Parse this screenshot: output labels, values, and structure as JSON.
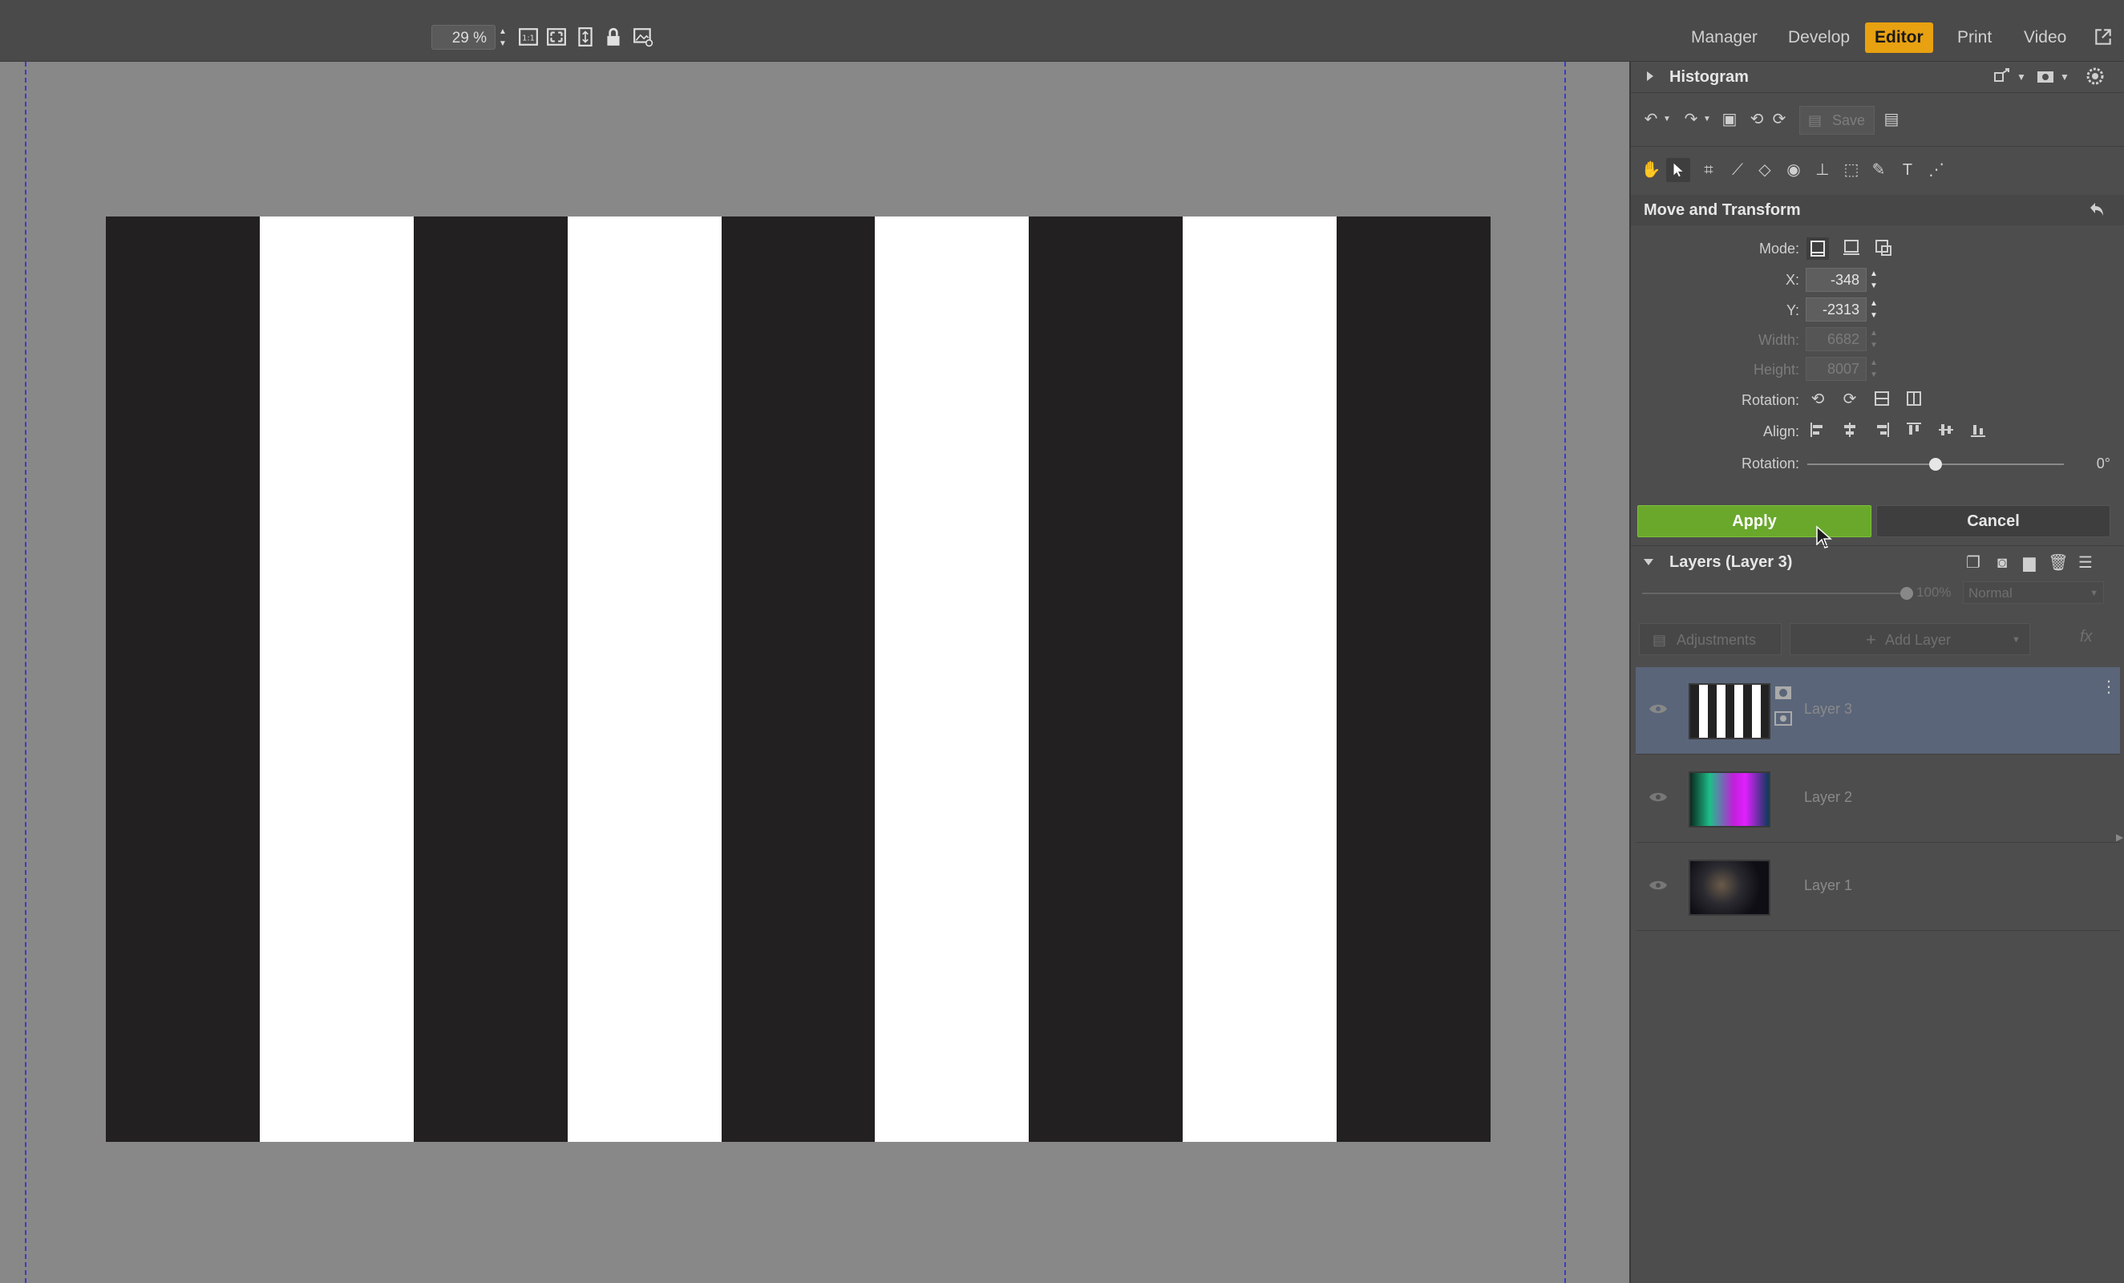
{
  "toolbar": {
    "zoom_value": "29 %",
    "icons": [
      "fit-1to1-icon",
      "fit-screen-icon",
      "fit-width-icon",
      "lock-icon",
      "image-settings-icon"
    ]
  },
  "nav": {
    "items": [
      {
        "label": "Manager",
        "active": false
      },
      {
        "label": "Develop",
        "active": false
      },
      {
        "label": "Editor",
        "active": true
      },
      {
        "label": "Print",
        "active": false
      },
      {
        "label": "Video",
        "active": false
      }
    ],
    "accent_color": "#e8a110"
  },
  "canvas": {
    "stripes": [
      "black",
      "white",
      "black",
      "white",
      "black",
      "white",
      "black",
      "white",
      "black"
    ],
    "colors": {
      "black": "#222020",
      "white": "#ffffff",
      "background": "#888888",
      "guide": "#3a3ad0"
    }
  },
  "histogram": {
    "title": "Histogram"
  },
  "edit_toolbar": {
    "save_label": "Save"
  },
  "move_transform": {
    "title": "Move and Transform",
    "mode_label": "Mode:",
    "x_label": "X:",
    "x_value": "-348",
    "y_label": "Y:",
    "y_value": "-2313",
    "width_label": "Width:",
    "width_value": "6682",
    "height_label": "Height:",
    "height_value": "8007",
    "rotation_label": "Rotation:",
    "align_label": "Align:",
    "rotation_slider_label": "Rotation:",
    "rotation_value": "0°",
    "rotation_fraction": 0.5,
    "apply_label": "Apply",
    "cancel_label": "Cancel",
    "apply_color": "#6aa82c"
  },
  "layers": {
    "title": "Layers (Layer 3)",
    "opacity_value": "100%",
    "opacity_fraction": 1.0,
    "blend_mode": "Normal",
    "adjustments_label": "Adjustments",
    "add_layer_label": "Add Layer",
    "fx_label": "fx",
    "items": [
      {
        "name": "Layer 3",
        "selected": true
      },
      {
        "name": "Layer 2",
        "selected": false
      },
      {
        "name": "Layer 1",
        "selected": false
      }
    ]
  }
}
